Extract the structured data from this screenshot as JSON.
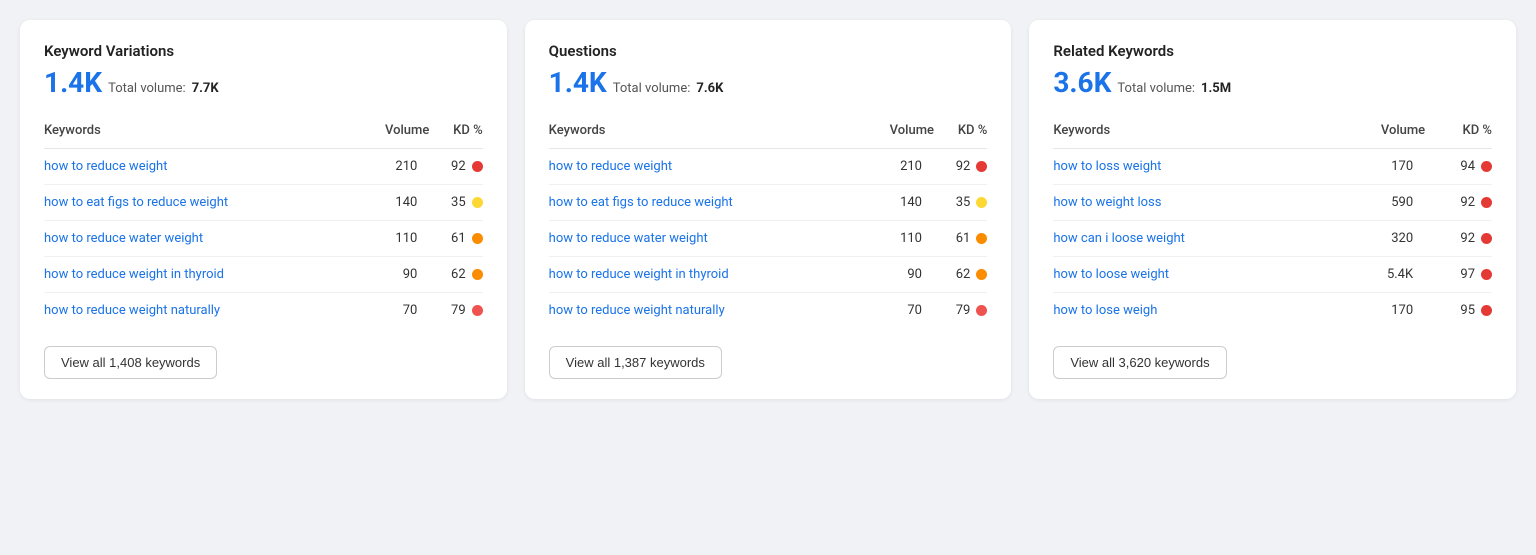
{
  "cards": [
    {
      "id": "keyword-variations",
      "title": "Keyword Variations",
      "count": "1.4K",
      "volume_label": "Total volume:",
      "volume_value": "7.7K",
      "columns": {
        "keywords": "Keywords",
        "volume": "Volume",
        "kd": "KD %"
      },
      "rows": [
        {
          "keyword": "how to reduce weight",
          "volume": "210",
          "kd": "92",
          "dot": "dot-red"
        },
        {
          "keyword": "how to eat figs to reduce weight",
          "volume": "140",
          "kd": "35",
          "dot": "dot-yellow"
        },
        {
          "keyword": "how to reduce water weight",
          "volume": "110",
          "kd": "61",
          "dot": "dot-orange"
        },
        {
          "keyword": "how to reduce weight in thyroid",
          "volume": "90",
          "kd": "62",
          "dot": "dot-orange"
        },
        {
          "keyword": "how to reduce weight naturally",
          "volume": "70",
          "kd": "79",
          "dot": "dot-light-red"
        }
      ],
      "view_all_label": "View all 1,408 keywords"
    },
    {
      "id": "questions",
      "title": "Questions",
      "count": "1.4K",
      "volume_label": "Total volume:",
      "volume_value": "7.6K",
      "columns": {
        "keywords": "Keywords",
        "volume": "Volume",
        "kd": "KD %"
      },
      "rows": [
        {
          "keyword": "how to reduce weight",
          "volume": "210",
          "kd": "92",
          "dot": "dot-red"
        },
        {
          "keyword": "how to eat figs to reduce weight",
          "volume": "140",
          "kd": "35",
          "dot": "dot-yellow"
        },
        {
          "keyword": "how to reduce water weight",
          "volume": "110",
          "kd": "61",
          "dot": "dot-orange"
        },
        {
          "keyword": "how to reduce weight in thyroid",
          "volume": "90",
          "kd": "62",
          "dot": "dot-orange"
        },
        {
          "keyword": "how to reduce weight naturally",
          "volume": "70",
          "kd": "79",
          "dot": "dot-light-red"
        }
      ],
      "view_all_label": "View all 1,387 keywords"
    },
    {
      "id": "related-keywords",
      "title": "Related Keywords",
      "count": "3.6K",
      "volume_label": "Total volume:",
      "volume_value": "1.5M",
      "columns": {
        "keywords": "Keywords",
        "volume": "Volume",
        "kd": "KD %"
      },
      "rows": [
        {
          "keyword": "how to loss weight",
          "volume": "170",
          "kd": "94",
          "dot": "dot-red"
        },
        {
          "keyword": "how to weight loss",
          "volume": "590",
          "kd": "92",
          "dot": "dot-red"
        },
        {
          "keyword": "how can i loose weight",
          "volume": "320",
          "kd": "92",
          "dot": "dot-red"
        },
        {
          "keyword": "how to loose weight",
          "volume": "5.4K",
          "kd": "97",
          "dot": "dot-red"
        },
        {
          "keyword": "how to lose weigh",
          "volume": "170",
          "kd": "95",
          "dot": "dot-red"
        }
      ],
      "view_all_label": "View all 3,620 keywords"
    }
  ]
}
